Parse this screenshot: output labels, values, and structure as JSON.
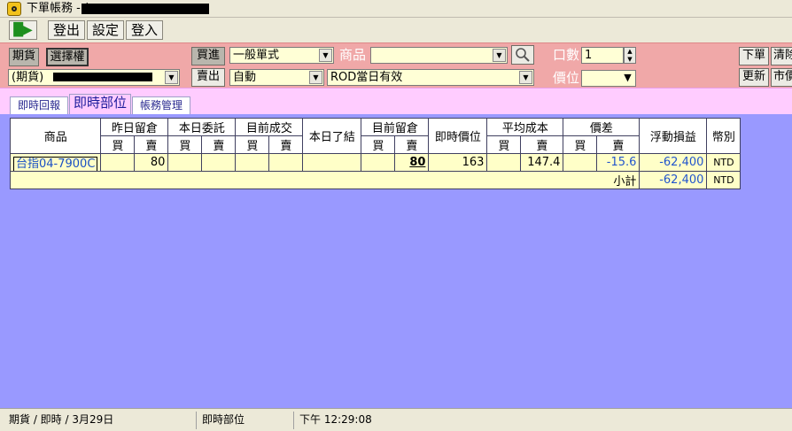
{
  "window": {
    "title": "下單帳務 - ("
  },
  "toolbar": {
    "logout": "登出",
    "settings": "設定",
    "login": "登入"
  },
  "order": {
    "futures_btn": "期貨",
    "options_btn": "選擇權",
    "buy_btn": "買進",
    "sell_btn": "賣出",
    "order_type": "一般單式",
    "price_mode": "自動",
    "validity": "ROD當日有效",
    "account": "(期貨)",
    "product_label": "商品",
    "product_value": "",
    "qty_label": "口數",
    "qty_value": "1",
    "price_label": "價位",
    "place_btn": "下單",
    "clear_btn": "清除",
    "refresh_btn": "更新",
    "market_btn": "市價"
  },
  "tabs": [
    {
      "label": "即時回報"
    },
    {
      "label": "即時部位"
    },
    {
      "label": "帳務管理"
    }
  ],
  "table": {
    "headers": {
      "product": "商品",
      "prev_pos": "昨日留倉",
      "today_order": "本日委託",
      "current_deal": "目前成交",
      "today_closed": "本日了結",
      "current_pos": "目前留倉",
      "last_price": "即時價位",
      "avg_cost": "平均成本",
      "diff": "價差",
      "float_pl": "浮動損益",
      "currency": "幣別",
      "buy": "買",
      "sell": "賣"
    },
    "rows": [
      {
        "product": "台指04-7900C",
        "prev_buy": "",
        "prev_sell": "80",
        "order_buy": "",
        "order_sell": "",
        "deal_buy": "",
        "deal_sell": "",
        "closed": "",
        "pos_buy": "",
        "pos_sell": "80",
        "last_price": "163",
        "cost_buy": "",
        "cost_sell": "147.4",
        "diff_buy": "",
        "diff_sell": "-15.6",
        "float_pl": "-62,400",
        "currency": "NTD"
      }
    ],
    "subtotal": {
      "label": "小計",
      "float_pl": "-62,400",
      "currency": "NTD"
    }
  },
  "status": {
    "left": "期貨 / 即時 /  3月29日",
    "middle": "即時部位",
    "time": "下午 12:29:08"
  }
}
